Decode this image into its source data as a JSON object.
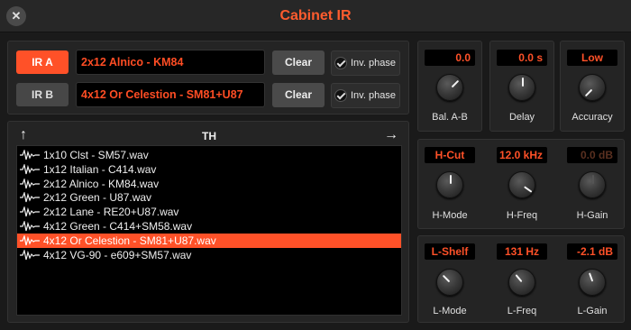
{
  "window": {
    "title": "Cabinet IR",
    "close_glyph": "✕"
  },
  "ir_a": {
    "button": "IR A",
    "name": "2x12 Alnico - KM84",
    "clear": "Clear",
    "inv_phase": "Inv. phase",
    "inv_checked": true
  },
  "ir_b": {
    "button": "IR B",
    "name": "4x12 Or Celestion - SM81+U87",
    "clear": "Clear",
    "inv_phase": "Inv. phase",
    "inv_checked": true
  },
  "browser": {
    "title": "TH",
    "up_icon": "↑",
    "forward_icon": "→",
    "files": [
      "1x10 Clst - SM57.wav",
      "1x12 Italian - C414.wav",
      "2x12 Alnico - KM84.wav",
      "2x12 Green - U87.wav",
      "2x12 Lane - RE20+U87.wav",
      "4x12 Green - C414+SM58.wav",
      "4x12 Or Celestion - SM81+U87.wav",
      "4x12 VG-90 - e609+SM57.wav"
    ],
    "selected_index": 6
  },
  "mix": {
    "bal": {
      "display": "0.0",
      "label": "Bal. A-B"
    },
    "delay": {
      "display": "0.0 s",
      "label": "Delay"
    },
    "accuracy": {
      "display": "Low",
      "label": "Accuracy"
    }
  },
  "high": {
    "mode": {
      "display": "H-Cut",
      "label": "H-Mode"
    },
    "freq": {
      "display": "12.0 kHz",
      "label": "H-Freq"
    },
    "gain": {
      "display": "0.0 dB",
      "label": "H-Gain"
    }
  },
  "low": {
    "mode": {
      "display": "L-Shelf",
      "label": "L-Mode"
    },
    "freq": {
      "display": "131 Hz",
      "label": "L-Freq"
    },
    "gain": {
      "display": "-2.1 dB",
      "label": "L-Gain"
    }
  },
  "colors": {
    "accent": "#ff5128",
    "panel": "#242424",
    "display_bg": "#000000"
  }
}
